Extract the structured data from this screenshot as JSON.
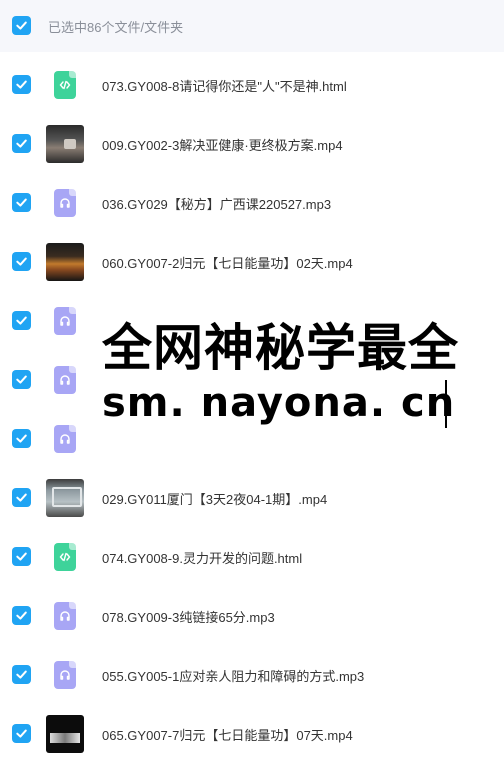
{
  "header": {
    "selection_text": "已选中86个文件/文件夹"
  },
  "files": [
    {
      "name": "073.GY008-8请记得你还是\"人\"不是神.html",
      "type": "html"
    },
    {
      "name": "009.GY002-3解决亚健康·更终极方案.mp4",
      "type": "video"
    },
    {
      "name": "036.GY029【秘方】广西课220527.mp3",
      "type": "audio"
    },
    {
      "name": "060.GY007-2归元【七日能量功】02天.mp4",
      "type": "video"
    },
    {
      "name": "",
      "type": "audio"
    },
    {
      "name": "",
      "type": "audio"
    },
    {
      "name": "",
      "type": "audio"
    },
    {
      "name": "029.GY011厦门【3天2夜04-1期】.mp4",
      "type": "video"
    },
    {
      "name": "074.GY008-9.灵力开发的问题.html",
      "type": "html"
    },
    {
      "name": "078.GY009-3纯链接65分.mp3",
      "type": "audio"
    },
    {
      "name": "055.GY005-1应对亲人阻力和障碍的方式.mp3",
      "type": "audio"
    },
    {
      "name": "065.GY007-7归元【七日能量功】07天.mp4",
      "type": "video"
    }
  ],
  "watermark": {
    "title": "全网神秘学最全",
    "url": "sm. nayona. cn"
  },
  "colors": {
    "checkbox": "#20a4f3",
    "html_icon": "#3ed39a",
    "audio_icon": "#a8a6f5",
    "header_bg": "#f6f7fb"
  }
}
